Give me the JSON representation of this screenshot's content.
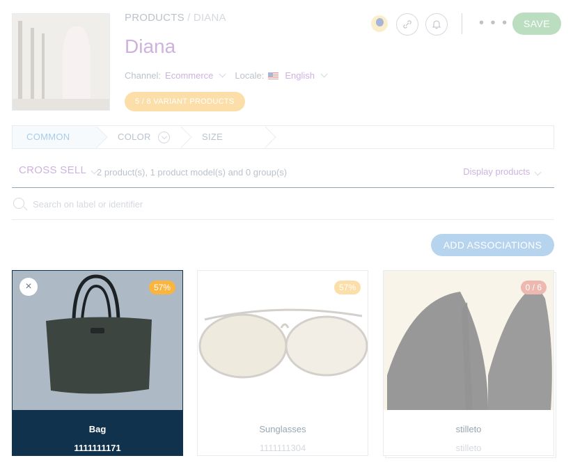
{
  "header": {
    "breadcrumb_root": "PRODUCTS",
    "breadcrumb_sep": "/",
    "breadcrumb_current": "DIANA",
    "title": "Diana",
    "channel_label": "Channel:",
    "channel_value": "Ecommerce",
    "locale_label": "Locale:",
    "locale_value": "English",
    "variant_badge": "5 / 8 VARIANT PRODUCTS",
    "save_label": "SAVE",
    "more_label": "• • •"
  },
  "tabs": [
    {
      "label": "COMMON"
    },
    {
      "label": "COLOR"
    },
    {
      "label": "SIZE"
    }
  ],
  "associations": {
    "type_label": "CROSS SELL",
    "summary": "2 product(s), 1 product model(s) and 0 group(s)",
    "display_label": "Display products",
    "search_placeholder": "Search on label or identifier",
    "add_label": "ADD ASSOCIATIONS"
  },
  "cards": [
    {
      "name": "Bag",
      "identifier": "1111111171",
      "badge": "57%",
      "badge_color": "#f9b53f"
    },
    {
      "name": "Sunglasses",
      "identifier": "1111111304",
      "badge": "57%",
      "badge_color": "#f9b53f"
    },
    {
      "name": "stilleto",
      "identifier": "stilleto",
      "badge": "0 / 6",
      "badge_color": "#d4604f"
    }
  ],
  "icons": {
    "remove": "×",
    "link": "⚲",
    "bell": "🔔"
  }
}
